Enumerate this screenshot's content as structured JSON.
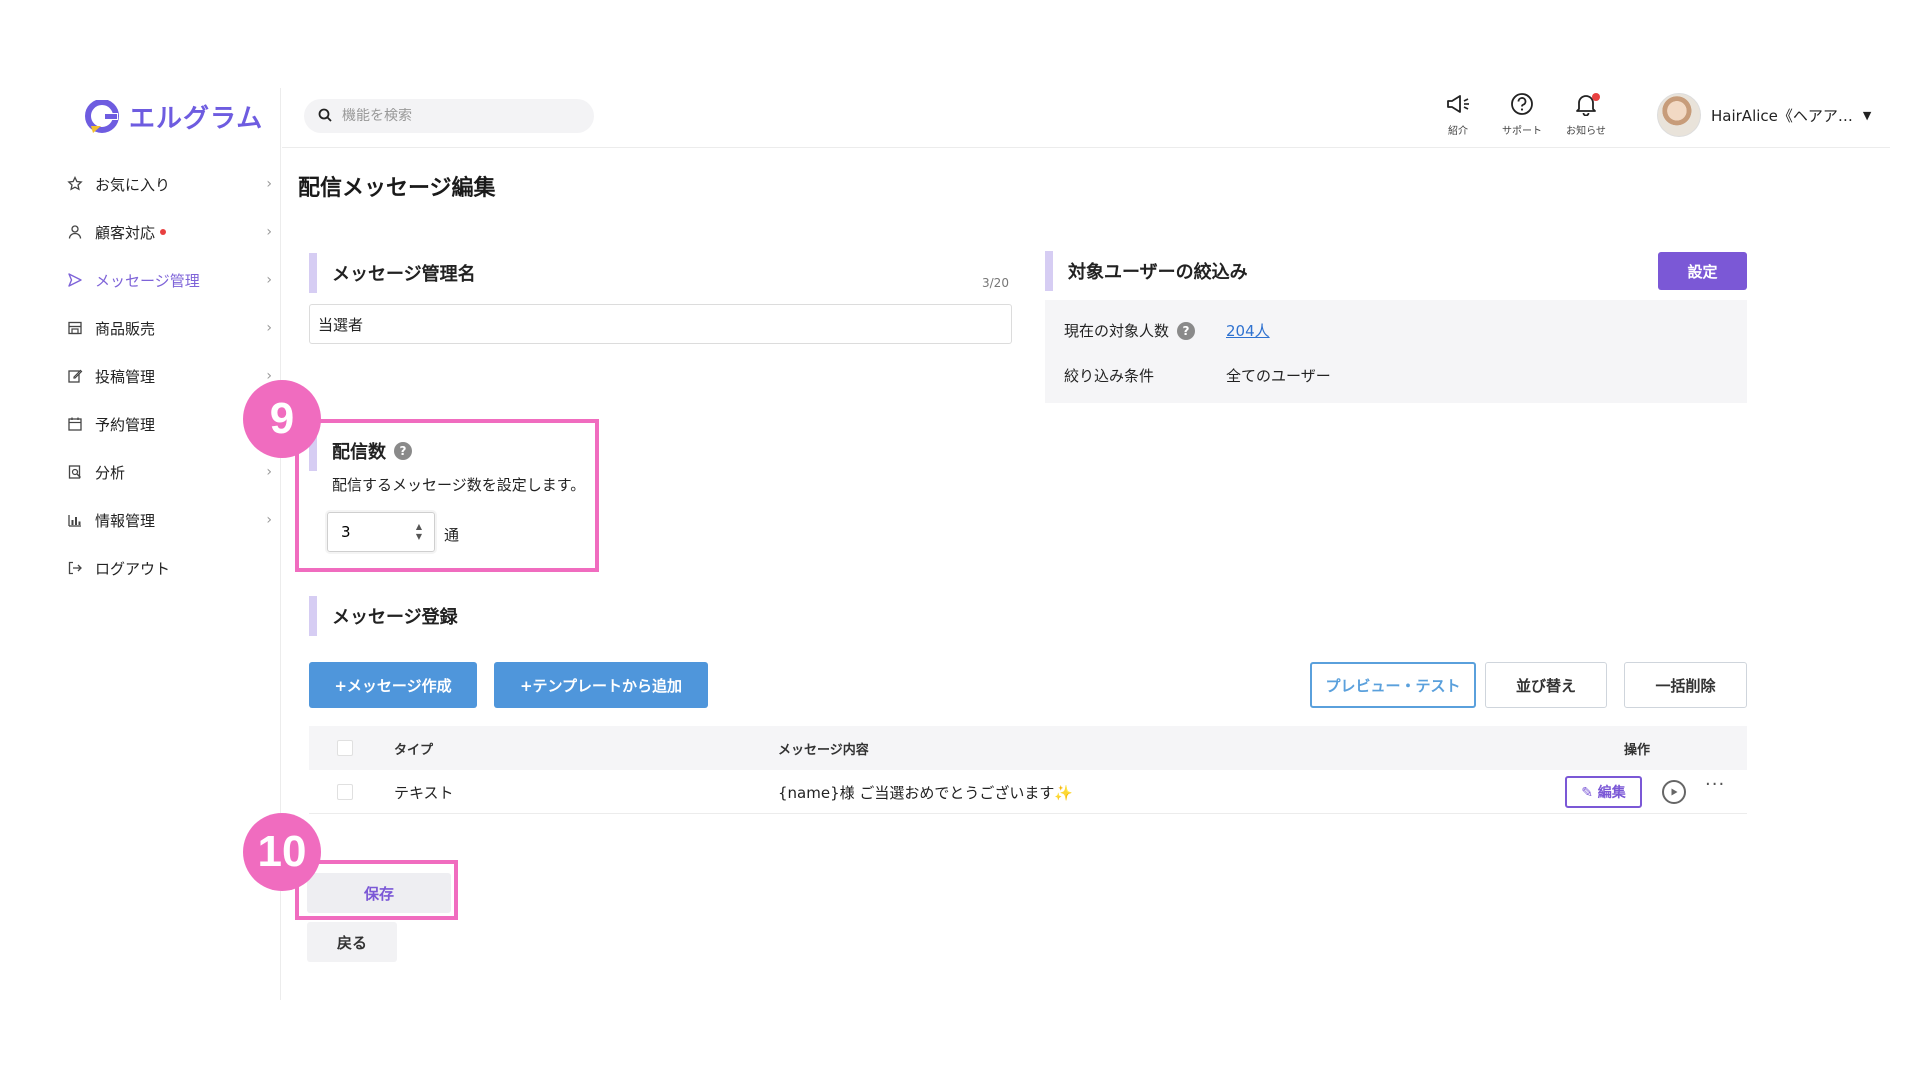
{
  "app": {
    "logo_text": "エルグラム",
    "brand_color": "#7b58d6",
    "accent_blue": "#4f96db",
    "highlight_color": "#f06cbf"
  },
  "search": {
    "placeholder": "機能を検索",
    "icon": "search-icon"
  },
  "header_tools": [
    {
      "label": "紹介",
      "icon": "megaphone-icon"
    },
    {
      "label": "サポート",
      "icon": "help-circle-icon"
    },
    {
      "label": "お知らせ",
      "icon": "bell-icon"
    }
  ],
  "profile": {
    "name": "HairAlice《ヘアア…"
  },
  "sidebar": {
    "items": [
      {
        "label": "お気に入り",
        "icon": "star-icon",
        "chevron": true
      },
      {
        "label": "顧客対応",
        "icon": "user-icon",
        "chevron": true,
        "dot": true
      },
      {
        "label": "メッセージ管理",
        "icon": "send-icon",
        "chevron": true,
        "active": true
      },
      {
        "label": "商品販売",
        "icon": "store-icon",
        "chevron": true
      },
      {
        "label": "投稿管理",
        "icon": "edit-icon",
        "chevron": true
      },
      {
        "label": "予約管理",
        "icon": "calendar-icon",
        "chevron": false
      },
      {
        "label": "分析",
        "icon": "analysis-icon",
        "chevron": true
      },
      {
        "label": "情報管理",
        "icon": "bar-chart-icon",
        "chevron": true
      },
      {
        "label": "ログアウト",
        "icon": "logout-icon",
        "chevron": false
      }
    ]
  },
  "page": {
    "title": "配信メッセージ編集"
  },
  "management_name": {
    "heading": "メッセージ管理名",
    "counter": "3/20",
    "value": "当選者"
  },
  "target_users": {
    "heading": "対象ユーザーの絞込み",
    "settings_button": "設定",
    "count_label": "現在の対象人数",
    "count_value": "204人",
    "condition_label": "絞り込み条件",
    "condition_value": "全てのユーザー"
  },
  "delivery_count": {
    "heading": "配信数",
    "description": "配信するメッセージ数を設定します。",
    "value": "3",
    "unit": "通"
  },
  "message_registration": {
    "heading": "メッセージ登録",
    "create_button": "+メッセージ作成",
    "template_button": "+テンプレートから追加",
    "preview_button": "プレビュー・テスト",
    "sort_button": "並び替え",
    "bulk_delete_button": "一括削除"
  },
  "table": {
    "columns": [
      "タイプ",
      "メッセージ内容",
      "操作"
    ],
    "rows": [
      {
        "type": "テキスト",
        "content": "{name}様 ご当選おめでとうございます✨",
        "edit_label": "編集"
      }
    ]
  },
  "actions": {
    "save": "保存",
    "back": "戻る"
  },
  "annotations": {
    "badge_9": "9",
    "badge_10": "10"
  }
}
